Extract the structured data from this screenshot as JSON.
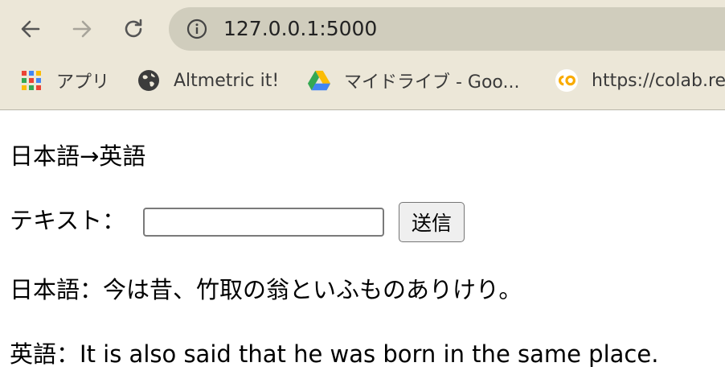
{
  "browser": {
    "url": "127.0.0.1:5000",
    "bookmarks": [
      {
        "label": "アプリ",
        "icon": "apps-grid-icon"
      },
      {
        "label": "Altmetric it!",
        "icon": "globe-icon"
      },
      {
        "label": "マイドライブ - Goo...",
        "icon": "google-drive-icon"
      },
      {
        "label": "https://colab.re",
        "icon": "colab-icon"
      }
    ]
  },
  "page": {
    "heading": "日本語→英語",
    "input_label": "テキスト：",
    "input_value": "",
    "submit_label": "送信",
    "japanese_label": "日本語：",
    "japanese_text": "今は昔、竹取の翁といふものありけり。",
    "english_label": "英語：",
    "english_text": "It is also said that he was born in the same place."
  }
}
